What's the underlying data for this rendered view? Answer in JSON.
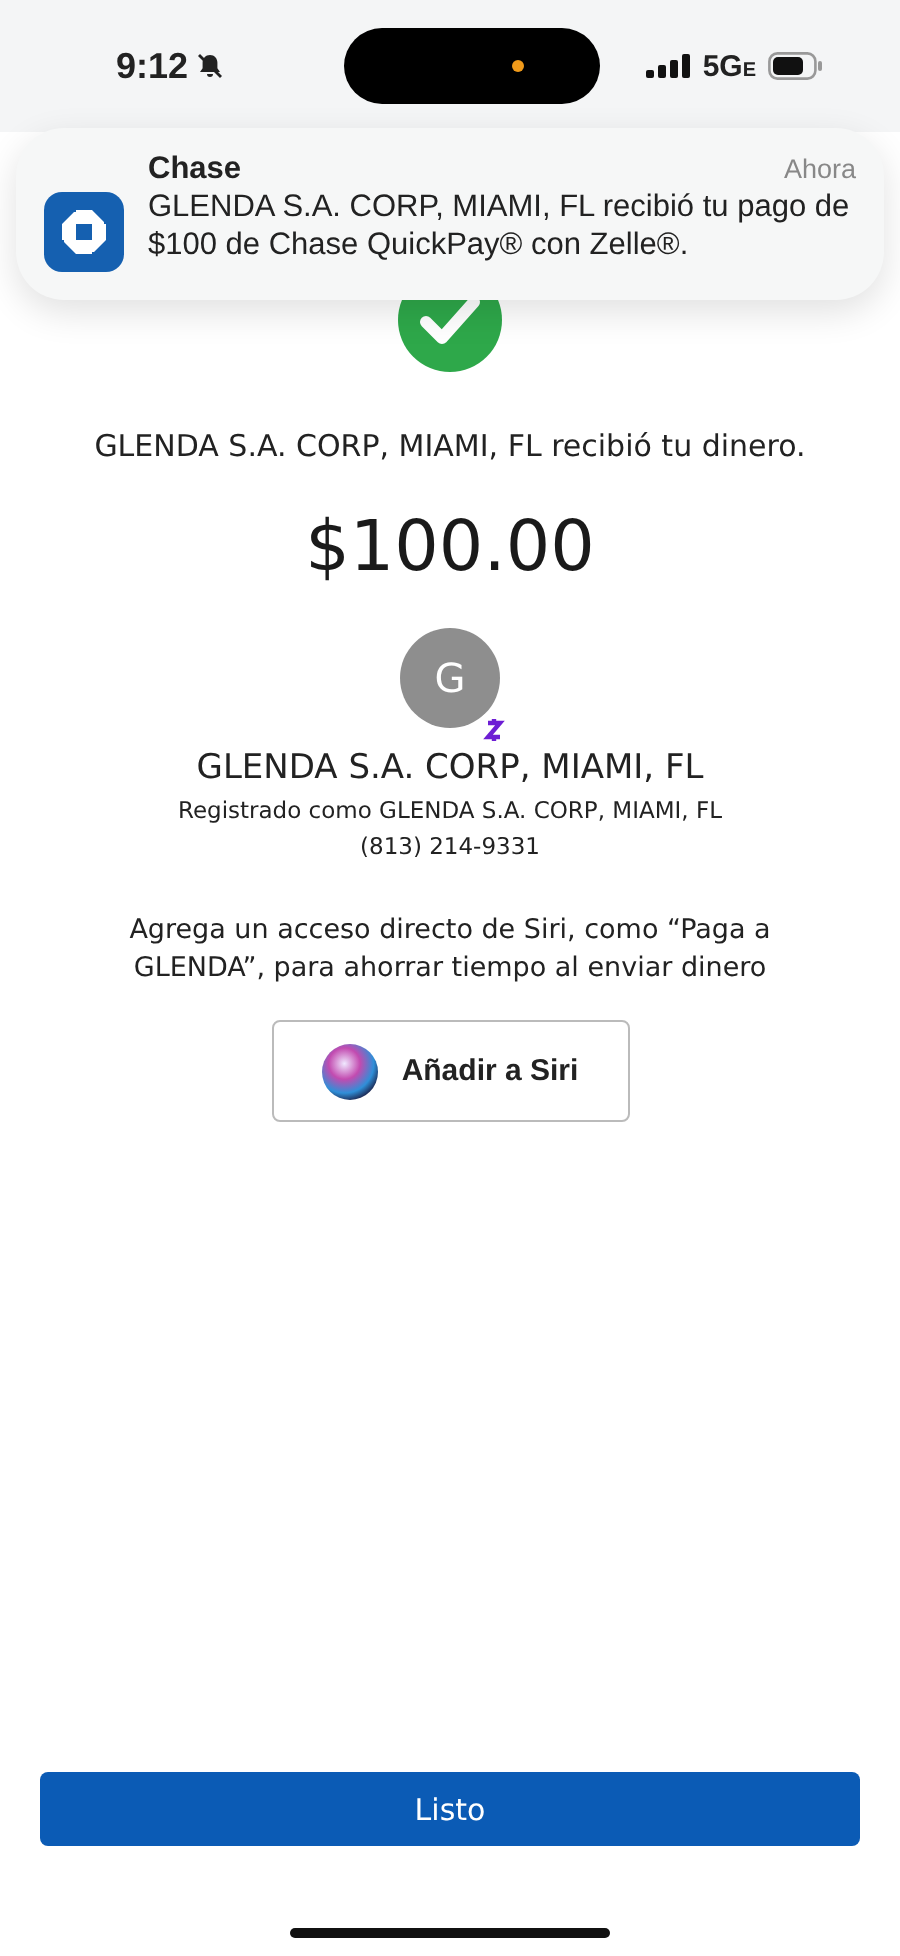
{
  "status_bar": {
    "time": "9:12",
    "network": "5G",
    "network_suffix": "E",
    "silent": true
  },
  "notification": {
    "app": "Chase",
    "time": "Ahora",
    "message": "GLENDA S.A. CORP, MIAMI, FL recibió tu pago de $100 de Chase QuickPay® con Zelle®."
  },
  "confirmation": {
    "message": "GLENDA S.A. CORP, MIAMI, FL recibió tu dinero.",
    "amount": "$100.00"
  },
  "recipient": {
    "initial": "G",
    "name": "GLENDA S.A. CORP, MIAMI, FL",
    "registered": "Registrado como GLENDA S.A. CORP, MIAMI, FL",
    "phone": "(813) 214-9331"
  },
  "siri": {
    "hint": "Agrega un acceso directo de Siri, como “Paga a GLENDA”, para ahorrar tiempo al enviar dinero",
    "button": "Añadir a Siri"
  },
  "done_button": "Listo"
}
